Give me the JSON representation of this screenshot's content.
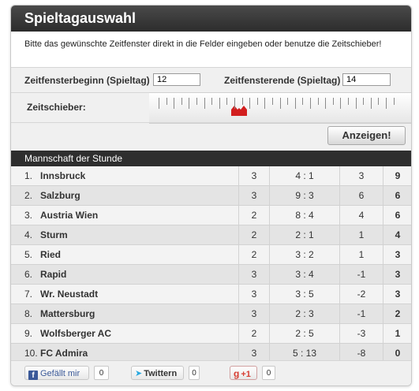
{
  "panel": {
    "title": "Spieltagauswahl",
    "description": "Bitte das gewünschte Zeitfenster direkt in die Felder eingeben oder benutze die Zeitschieber!"
  },
  "range": {
    "start_label": "Zeitfensterbeginn (Spieltag)",
    "start_value": "12",
    "end_label": "Zeitfensterende (Spieltag)",
    "end_value": "14"
  },
  "slider": {
    "label": "Zeitschieber:",
    "handle_color": "#d21e1e"
  },
  "submit_label": "Anzeigen!",
  "section_title": "Mannschaft der Stunde",
  "table": {
    "rows": [
      {
        "rank": "1.",
        "team": "Innsbruck",
        "games": "3",
        "goals": "4 : 1",
        "diff": "3",
        "points": "9"
      },
      {
        "rank": "2.",
        "team": "Salzburg",
        "games": "3",
        "goals": "9 : 3",
        "diff": "6",
        "points": "6"
      },
      {
        "rank": "3.",
        "team": "Austria Wien",
        "games": "2",
        "goals": "8 : 4",
        "diff": "4",
        "points": "6"
      },
      {
        "rank": "4.",
        "team": "Sturm",
        "games": "2",
        "goals": "2 : 1",
        "diff": "1",
        "points": "4"
      },
      {
        "rank": "5.",
        "team": "Ried",
        "games": "2",
        "goals": "3 : 2",
        "diff": "1",
        "points": "3"
      },
      {
        "rank": "6.",
        "team": "Rapid",
        "games": "3",
        "goals": "3 : 4",
        "diff": "-1",
        "points": "3"
      },
      {
        "rank": "7.",
        "team": "Wr. Neustadt",
        "games": "3",
        "goals": "3 : 5",
        "diff": "-2",
        "points": "3"
      },
      {
        "rank": "8.",
        "team": "Mattersburg",
        "games": "3",
        "goals": "2 : 3",
        "diff": "-1",
        "points": "2"
      },
      {
        "rank": "9.",
        "team": "Wolfsberger AC",
        "games": "2",
        "goals": "2 : 5",
        "diff": "-3",
        "points": "1"
      },
      {
        "rank": "10.",
        "team": "FC Admira",
        "games": "3",
        "goals": "5 : 13",
        "diff": "-8",
        "points": "0"
      }
    ]
  },
  "social": {
    "facebook_label": "Gefällt mir",
    "facebook_count": "0",
    "twitter_label": "Twittern",
    "twitter_count": "0",
    "google_label": "+1",
    "google_count": "0",
    "icons": [
      "facebook-icon",
      "twitter-icon",
      "google-plus-icon"
    ]
  }
}
